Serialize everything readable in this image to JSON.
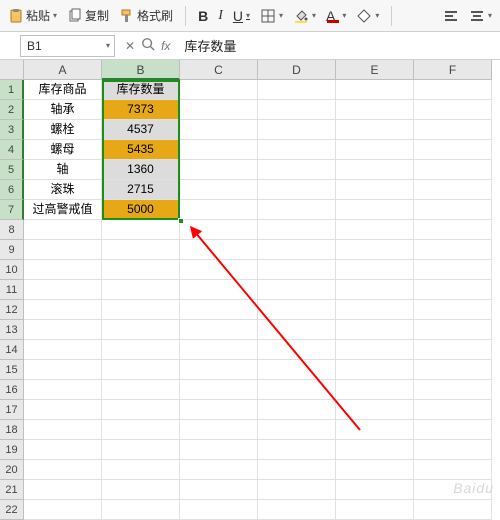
{
  "toolbar": {
    "paste": "粘贴",
    "copy": "复制",
    "format_painter": "格式刷",
    "bold": "B",
    "italic": "I",
    "underline": "U"
  },
  "colors": {
    "font_color": "#cc0000",
    "highlight": "#ffe04a",
    "fill": "#e6a817",
    "sel_border": "#1a8f1a"
  },
  "namebox": "B1",
  "fx_label": "fx",
  "fx_value": "库存数量",
  "columns": [
    "A",
    "B",
    "C",
    "D",
    "E",
    "F"
  ],
  "row_count": 22,
  "selected_col_index": 1,
  "selected_rows": [
    1,
    2,
    3,
    4,
    5,
    6,
    7
  ],
  "table": {
    "headers": [
      "库存商品",
      "库存数量"
    ],
    "rows": [
      {
        "a": "轴承",
        "b": "7373",
        "hl": true
      },
      {
        "a": "螺栓",
        "b": "4537",
        "hl": false
      },
      {
        "a": "螺母",
        "b": "5435",
        "hl": true
      },
      {
        "a": "轴",
        "b": "1360",
        "hl": false
      },
      {
        "a": "滚珠",
        "b": "2715",
        "hl": false
      },
      {
        "a": "过高警戒值",
        "b": "5000",
        "hl": true
      }
    ]
  },
  "watermark": "Baidu"
}
